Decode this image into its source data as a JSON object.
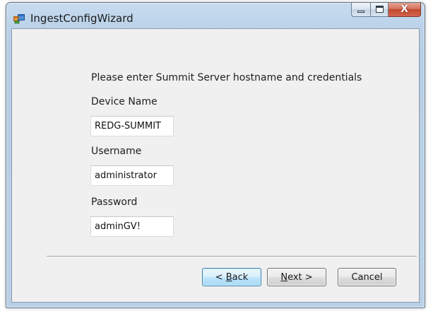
{
  "window": {
    "title": "IngestConfigWizard",
    "controls": {
      "minimize": "minimize",
      "maximize": "maximize",
      "close": "X"
    }
  },
  "form": {
    "instruction": "Please enter Summit Server hostname and credentials",
    "device_name": {
      "label": "Device Name",
      "value": "REDG-SUMMIT"
    },
    "username": {
      "label": "Username",
      "value": "administrator"
    },
    "password": {
      "label": "Password",
      "value": "adminGV!"
    }
  },
  "buttons": {
    "back": {
      "prefix": "< ",
      "mnemonic": "B",
      "rest": "ack"
    },
    "next": {
      "mnemonic": "N",
      "rest": "ext >"
    },
    "cancel": {
      "label": "Cancel"
    }
  },
  "colors": {
    "frame": "#b9d0e7",
    "client": "#f0f0f0",
    "close_button": "#c2492f",
    "focused_button": "#bee6fd"
  },
  "icons": {
    "app": "app-window-icon"
  }
}
